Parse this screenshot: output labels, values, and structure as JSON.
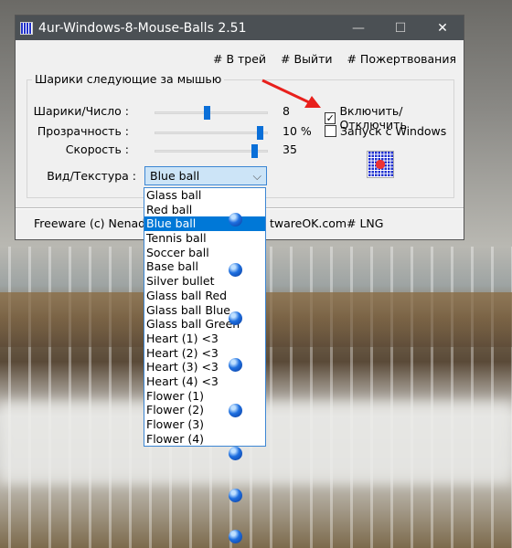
{
  "window": {
    "title": "4ur-Windows-8-Mouse-Balls 2.51"
  },
  "menu": {
    "tray": "# В трей",
    "exit": "# Выйти",
    "donate": "# Пожертвования"
  },
  "group": {
    "title": "Шарики следующие за мышью"
  },
  "sliders": [
    {
      "label": "Шарики/Число :",
      "value": "8",
      "level": 0.45
    },
    {
      "label": "Прозрачность :",
      "value": "10 %",
      "level": 0.95
    },
    {
      "label": "Скорость :",
      "value": "35",
      "level": 0.9
    }
  ],
  "checkboxes": [
    {
      "label": "Включить/Отключить",
      "checked": true
    },
    {
      "label": "Запуск с Windows",
      "checked": false
    }
  ],
  "texture": {
    "label": "Вид/Текстура :",
    "selected": "Blue ball",
    "options": [
      "Glass ball",
      "Red ball",
      "Blue ball",
      "Tennis ball",
      "Soccer ball",
      "Base ball",
      "Silver bullet",
      "Glass ball Red",
      "Glass ball Blue",
      "Glass ball Green",
      "Heart (1) <3",
      "Heart (2) <3",
      "Heart (3) <3",
      "Heart (4) <3",
      "Flower (1)",
      "Flower (2)",
      "Flower (3)",
      "Flower (4)"
    ]
  },
  "footer": {
    "freeware": "Freeware (c) Nenad H",
    "site": "twareOK.com",
    "lng": "# LNG"
  },
  "colors": {
    "accent": "#0078d7",
    "titlebar": "#4b5054",
    "arrow": "#e8201c"
  }
}
